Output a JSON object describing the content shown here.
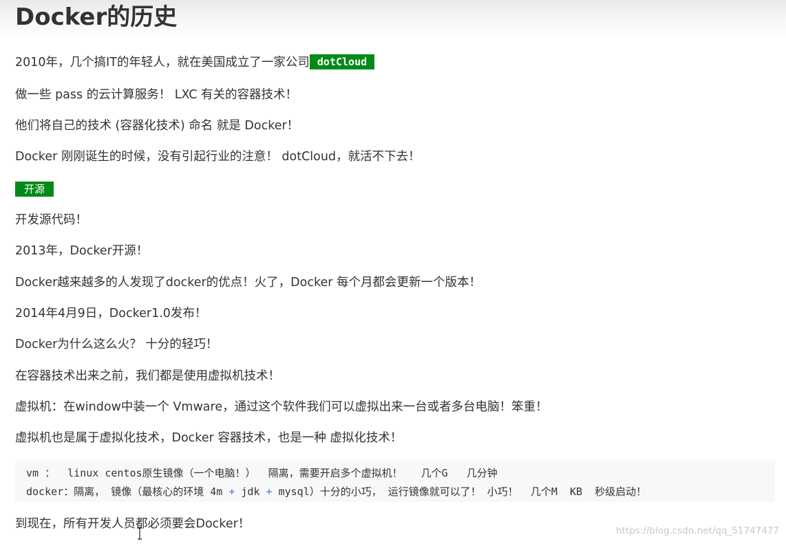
{
  "heading": "Docker的历史",
  "paragraphs": {
    "p1_text": "2010年，几个搞IT的年轻人，就在美国成立了一家公司",
    "p1_tag": "dotCloud",
    "p2": "做一些  pass 的云计算服务！  LXC  有关的容器技术！",
    "p3": "他们将自己的技术 (容器化技术)  命名 就是 Docker！",
    "p4": "Docker 刚刚诞生的时候，没有引起行业的注意！ dotCloud，就活不下去！",
    "open_tag": "开源",
    "p5": "开发源代码！",
    "p6": "2013年，Docker开源！",
    "p7": "Docker越来越多的人发现了docker的优点！火了，Docker 每个月都会更新一个版本！",
    "p8": "2014年4月9日，Docker1.0发布！",
    "p9": "Docker为什么这么火？ 十分的轻巧！",
    "p10": "在容器技术出来之前，我们都是使用虚拟机技术！",
    "p11": "虚拟机：在window中装一个 Vmware，通过这个软件我们可以虚拟出来一台或者多台电脑！笨重！",
    "p12": "虚拟机也是属于虚拟化技术，Docker 容器技术，也是一种 虚拟化技术！",
    "p13": "到现在，所有开发人员都必须要会Docker！"
  },
  "code": {
    "line1": "vm ：  linux centos原生镜像（一个电脑！）  隔离，需要开启多个虚拟机！   几个G   几分钟",
    "line2_a": "docker：隔离， 镜像（最核心的环境 4m ",
    "line2_plus1": "+",
    "line2_b": " jdk ",
    "line2_plus2": "+",
    "line2_c": " mysql）十分的小巧， 运行镜像就可以了！ 小巧！  几个M  KB  秒级启动！"
  },
  "watermark": "https://blog.csdn.net/qq_51747477",
  "icons": {
    "cursor": "text-cursor-icon"
  },
  "colors": {
    "tag_background": "#008a17",
    "tag_text": "#ffffff",
    "code_background": "#f6f8fa",
    "code_operator": "#4a7ab8",
    "body_text": "#333333"
  }
}
